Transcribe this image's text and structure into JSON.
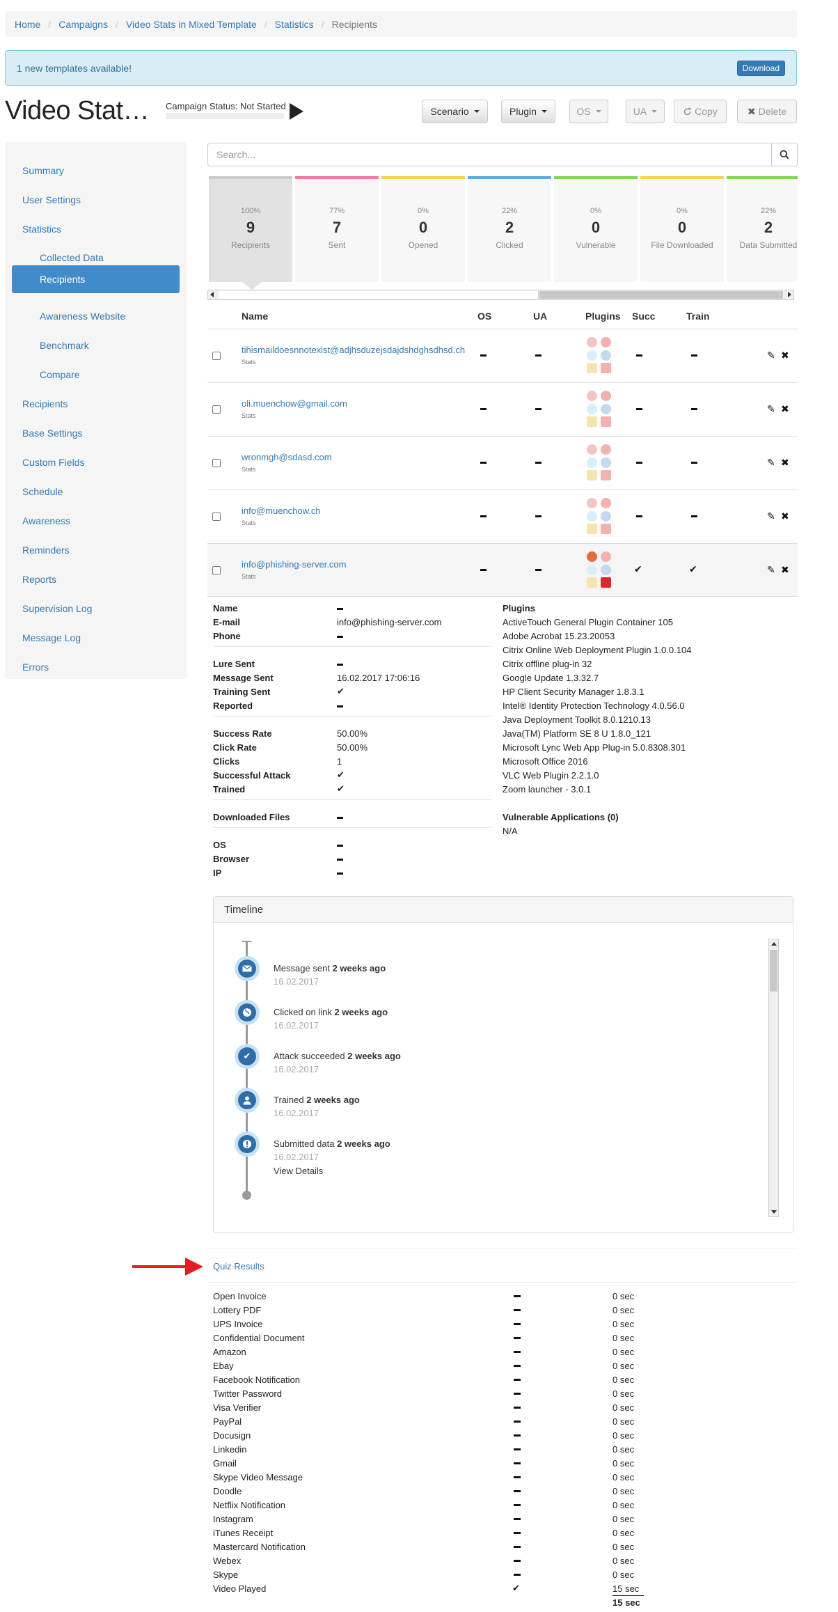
{
  "breadcrumb": [
    "Home",
    "Campaigns",
    "Video Stats in Mixed Template",
    "Statistics",
    "Recipients"
  ],
  "alert": {
    "text": "1 new templates available!",
    "button": "Download"
  },
  "header": {
    "title": "Video Stat…",
    "campaign_status": "Campaign Status: Not Started",
    "buttons": {
      "scenario": "Scenario",
      "plugin": "Plugin",
      "os": "OS",
      "ua": "UA",
      "copy": "Copy",
      "delete": "Delete"
    }
  },
  "sidebar": {
    "items": [
      "Summary",
      "User Settings",
      "Statistics",
      "Collected Data",
      "Recipients",
      "Awareness Website",
      "Benchmark",
      "Compare",
      "Recipients",
      "Base Settings",
      "Custom Fields",
      "Schedule",
      "Awareness",
      "Reminders",
      "Reports",
      "Supervision Log",
      "Message Log",
      "Errors"
    ]
  },
  "search": {
    "placeholder": "Search..."
  },
  "stats": [
    {
      "pct": "100%",
      "count": "9",
      "label": "Recipients",
      "color": "#cccccc"
    },
    {
      "pct": "77%",
      "count": "7",
      "label": "Sent",
      "color": "#f47aa0"
    },
    {
      "pct": "0%",
      "count": "0",
      "label": "Opened",
      "color": "#f5d25a"
    },
    {
      "pct": "22%",
      "count": "2",
      "label": "Clicked",
      "color": "#5aaee6"
    },
    {
      "pct": "0%",
      "count": "0",
      "label": "Vulnerable",
      "color": "#7ed957"
    },
    {
      "pct": "0%",
      "count": "0",
      "label": "File Downloaded",
      "color": "#f5d25a"
    },
    {
      "pct": "22%",
      "count": "2",
      "label": "Data Submitted",
      "color": "#7ed957"
    }
  ],
  "table": {
    "headers": {
      "name": "Name",
      "os": "OS",
      "ua": "UA",
      "plugins": "Plugins",
      "succ": "Succ",
      "train": "Train"
    },
    "rows": [
      {
        "email": "tihismaildoesnnotexist@adjhsduzejsdajdshdghsdhsd.ch",
        "sub": "Stats",
        "succ": false,
        "train": false
      },
      {
        "email": "oli.muenchow@gmail.com",
        "sub": "Stats",
        "succ": false,
        "train": false
      },
      {
        "email": "wronmgh@sdasd.com",
        "sub": "Stats",
        "succ": false,
        "train": false
      },
      {
        "email": "info@muenchow.ch",
        "sub": "Stats",
        "succ": false,
        "train": false
      },
      {
        "email": "info@phishing-server.com",
        "sub": "Stats",
        "succ": true,
        "train": true
      }
    ]
  },
  "details": {
    "labels": {
      "name": "Name",
      "email": "E-mail",
      "phone": "Phone",
      "lure_sent": "Lure Sent",
      "message_sent": "Message Sent",
      "training_sent": "Training Sent",
      "reported": "Reported",
      "success_rate": "Success Rate",
      "click_rate": "Click Rate",
      "clicks": "Clicks",
      "successful_attack": "Successful Attack",
      "trained": "Trained",
      "downloaded_files": "Downloaded Files",
      "os": "OS",
      "browser": "Browser",
      "ip": "IP"
    },
    "email": "info@phishing-server.com",
    "message_sent": "16.02.2017 17:06:16",
    "success_rate": "50.00%",
    "click_rate": "50.00%",
    "clicks": "1",
    "plugins_title": "Plugins",
    "plugins": [
      "ActiveTouch General Plugin Container 105",
      "Adobe Acrobat 15.23.20053",
      "Citrix Online Web Deployment Plugin 1.0.0.104",
      "Citrix offline plug-in 32",
      "Google Update 1.3.32.7",
      "HP Client Security Manager 1.8.3.1",
      "Intel® Identity Protection Technology 4.0.56.0",
      "Java Deployment Toolkit 8.0.1210.13",
      "Java(TM) Platform SE 8 U 1.8.0_121",
      "Microsoft Lync Web App Plug-in 5.0.8308.301",
      "Microsoft Office 2016",
      "VLC Web Plugin 2.2.1.0",
      "Zoom launcher - 3.0.1"
    ],
    "vuln_title": "Vulnerable Applications (0)",
    "vuln_value": "N/A"
  },
  "timeline": {
    "title": "Timeline",
    "events": [
      {
        "text": "Message sent",
        "ago": "2 weeks ago",
        "date": "16.02.2017",
        "icon": "envelope-icon"
      },
      {
        "text": "Clicked on link",
        "ago": "2 weeks ago",
        "date": "16.02.2017",
        "icon": "globe-icon"
      },
      {
        "text": "Attack succeeded",
        "ago": "2 weeks ago",
        "date": "16.02.2017",
        "icon": "check-icon"
      },
      {
        "text": "Trained",
        "ago": "2 weeks ago",
        "date": "16.02.2017",
        "icon": "user-icon"
      },
      {
        "text": "Submitted data",
        "ago": "2 weeks ago",
        "date": "16.02.2017",
        "icon": "exclamation-icon"
      }
    ],
    "view_details": "View Details"
  },
  "quiz": {
    "title": "Quiz Results",
    "rows": [
      {
        "name": "Open Invoice",
        "done": false,
        "time": "0 sec"
      },
      {
        "name": "Lottery PDF",
        "done": false,
        "time": "0 sec"
      },
      {
        "name": "UPS Invoice",
        "done": false,
        "time": "0 sec"
      },
      {
        "name": "Confidential Document",
        "done": false,
        "time": "0 sec"
      },
      {
        "name": "Amazon",
        "done": false,
        "time": "0 sec"
      },
      {
        "name": "Ebay",
        "done": false,
        "time": "0 sec"
      },
      {
        "name": "Facebook Notification",
        "done": false,
        "time": "0 sec"
      },
      {
        "name": "Twitter Password",
        "done": false,
        "time": "0 sec"
      },
      {
        "name": "Visa Verifier",
        "done": false,
        "time": "0 sec"
      },
      {
        "name": "PayPal",
        "done": false,
        "time": "0 sec"
      },
      {
        "name": "Docusign",
        "done": false,
        "time": "0 sec"
      },
      {
        "name": "Linkedin",
        "done": false,
        "time": "0 sec"
      },
      {
        "name": "Gmail",
        "done": false,
        "time": "0 sec"
      },
      {
        "name": "Skype Video Message",
        "done": false,
        "time": "0 sec"
      },
      {
        "name": "Doodle",
        "done": false,
        "time": "0 sec"
      },
      {
        "name": "Netflix Notification",
        "done": false,
        "time": "0 sec"
      },
      {
        "name": "Instagram",
        "done": false,
        "time": "0 sec"
      },
      {
        "name": "iTunes Receipt",
        "done": false,
        "time": "0 sec"
      },
      {
        "name": "Mastercard Notification",
        "done": false,
        "time": "0 sec"
      },
      {
        "name": "Webex",
        "done": false,
        "time": "0 sec"
      },
      {
        "name": "Skype",
        "done": false,
        "time": "0 sec"
      },
      {
        "name": "Video Played",
        "done": true,
        "time": "15 sec"
      }
    ],
    "total": "15 sec"
  }
}
